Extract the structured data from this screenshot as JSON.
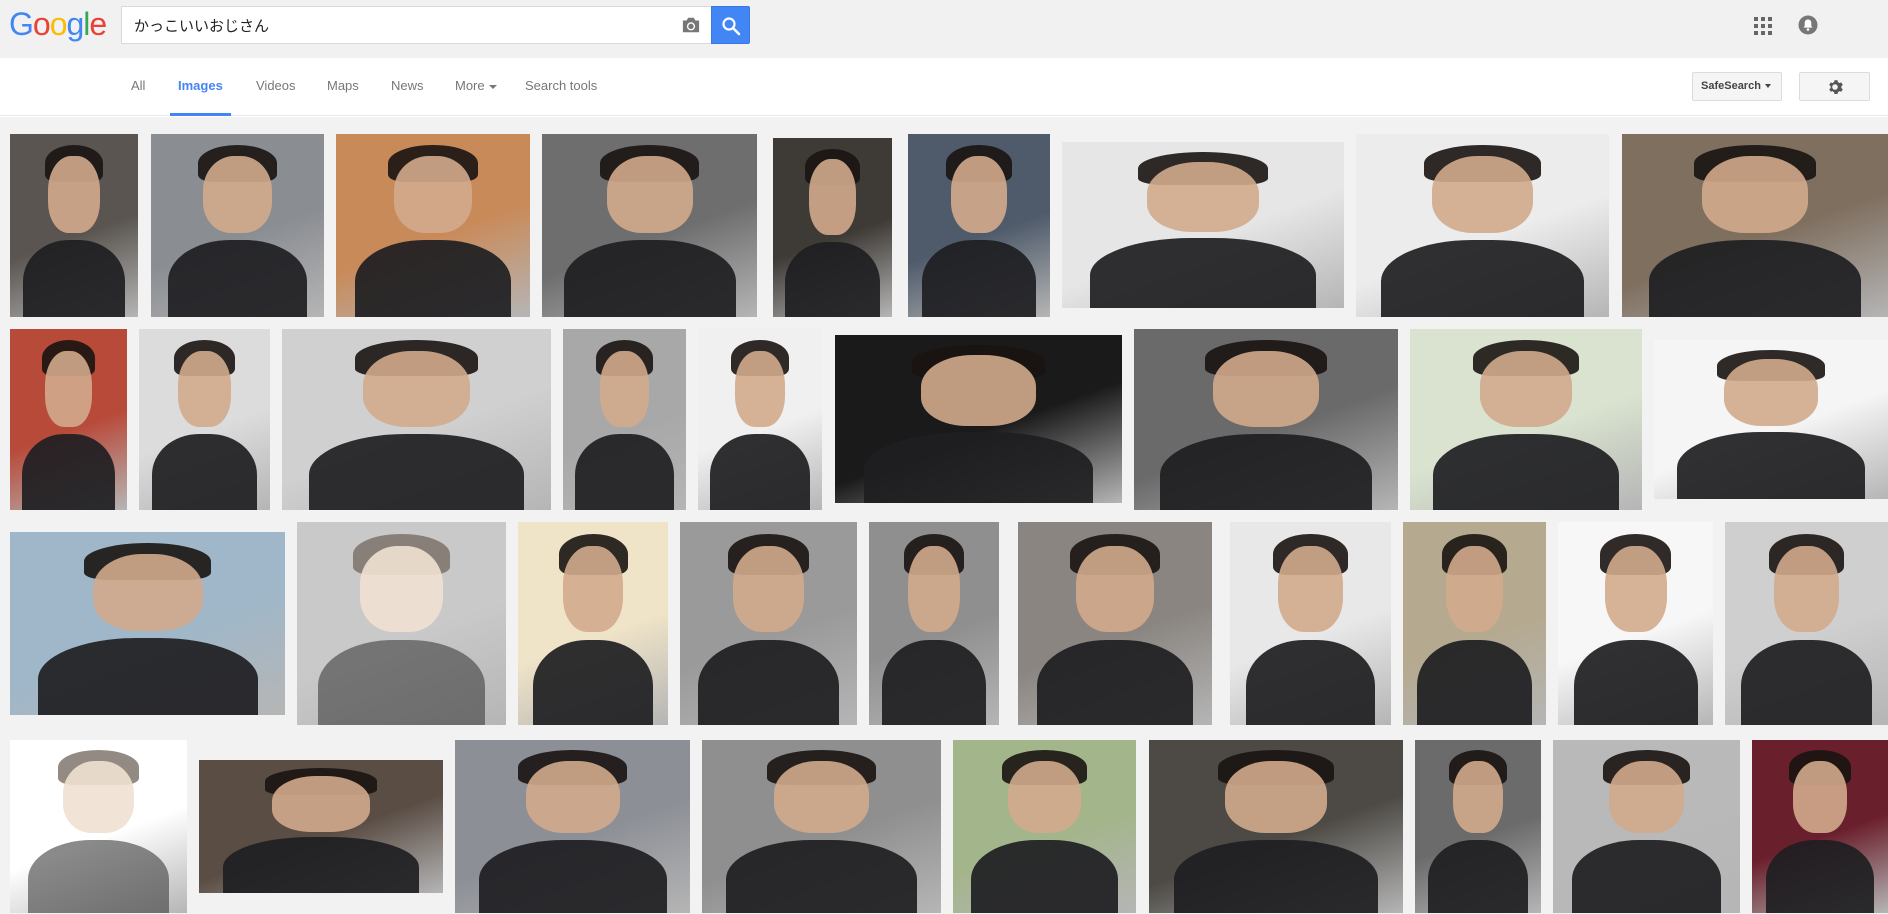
{
  "header": {
    "logo_letters": [
      {
        "ch": "G",
        "color": "#4285f4"
      },
      {
        "ch": "o",
        "color": "#ea4335"
      },
      {
        "ch": "o",
        "color": "#fbbc05"
      },
      {
        "ch": "g",
        "color": "#4285f4"
      },
      {
        "ch": "l",
        "color": "#34a853"
      },
      {
        "ch": "e",
        "color": "#ea4335"
      }
    ],
    "query": "かっこいいおじさん",
    "icons": {
      "camera": "camera-icon",
      "search": "search-icon",
      "apps": "apps-icon",
      "notifications": "bell-icon"
    },
    "accent": "#4285f4"
  },
  "tabs": [
    {
      "label": "All",
      "active": false
    },
    {
      "label": "Images",
      "active": true
    },
    {
      "label": "Videos",
      "active": false
    },
    {
      "label": "Maps",
      "active": false
    },
    {
      "label": "News",
      "active": false
    },
    {
      "label": "More",
      "active": false,
      "dropdown": true
    },
    {
      "label": "Search tools",
      "active": false
    }
  ],
  "toolbar": {
    "safesearch_label": "SafeSearch",
    "settings_icon": "gear-icon"
  },
  "results": {
    "thumbnails": [
      {
        "bg": "#5a5550",
        "style": "photo"
      },
      {
        "bg": "#8a8d92",
        "style": "photo"
      },
      {
        "bg": "#c98a5a",
        "style": "photo"
      },
      {
        "bg": "#6e6e6e",
        "style": "photo"
      },
      {
        "bg": "#3e3a36",
        "style": "photo"
      },
      {
        "bg": "#4f5b6b",
        "style": "photo"
      },
      {
        "bg": "#e6e6e6",
        "style": "photo"
      },
      {
        "bg": "#ececec",
        "style": "photo"
      },
      {
        "bg": "#7f6f5f",
        "style": "photo"
      },
      {
        "bg": "#b84a3a",
        "style": "photo"
      },
      {
        "bg": "#dcdcdc",
        "style": "photo"
      },
      {
        "bg": "#d0d0d0",
        "style": "photo"
      },
      {
        "bg": "#a8a8a8",
        "style": "photo"
      },
      {
        "bg": "#f0f0f0",
        "style": "photo"
      },
      {
        "bg": "#1a1a1a",
        "style": "photo"
      },
      {
        "bg": "#6a6a6a",
        "style": "photo"
      },
      {
        "bg": "#d9e3cf",
        "style": "photo"
      },
      {
        "bg": "#f5f5f5",
        "style": "photo"
      },
      {
        "bg": "#9fb7c9",
        "style": "photo"
      },
      {
        "bg": "#c9c9c9",
        "style": "sketch"
      },
      {
        "bg": "#f0e4c8",
        "style": "photo"
      },
      {
        "bg": "#9a9a9a",
        "style": "photo"
      },
      {
        "bg": "#8f8f8f",
        "style": "photo"
      },
      {
        "bg": "#8a8580",
        "style": "photo"
      },
      {
        "bg": "#e8e8e8",
        "style": "photo"
      },
      {
        "bg": "#b5a98f",
        "style": "photo"
      },
      {
        "bg": "#f7f7f7",
        "style": "photo"
      },
      {
        "bg": "#cfcfcf",
        "style": "photo"
      },
      {
        "bg": "#ffffff",
        "style": "sketch"
      },
      {
        "bg": "#5a4d44",
        "style": "photo"
      },
      {
        "bg": "#8c8f96",
        "style": "photo"
      },
      {
        "bg": "#8f8f8f",
        "style": "photo"
      },
      {
        "bg": "#a3b58a",
        "style": "photo"
      },
      {
        "bg": "#4d4a45",
        "style": "photo"
      },
      {
        "bg": "#6b6b6b",
        "style": "photo"
      },
      {
        "bg": "#b9b9b9",
        "style": "photo"
      },
      {
        "bg": "#6a1f2c",
        "style": "photo"
      }
    ]
  }
}
